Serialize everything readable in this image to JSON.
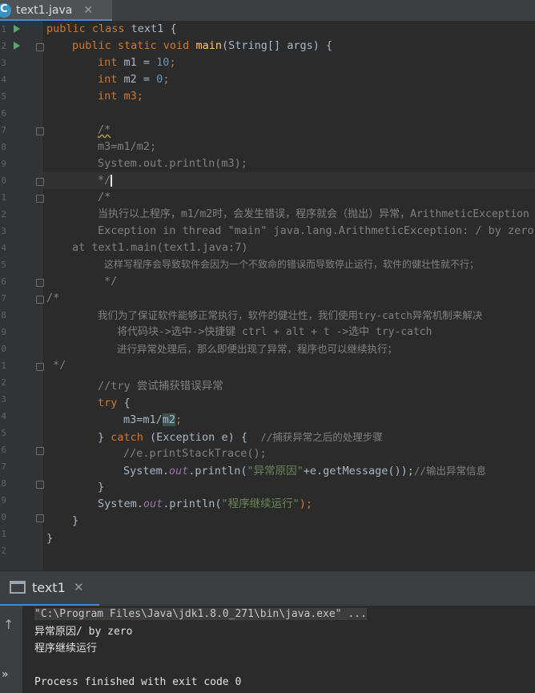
{
  "tab": {
    "icon": "java-class-icon",
    "label": "text1.java",
    "close": "✕"
  },
  "editor": {
    "line_numbers": [
      "1",
      "2",
      "3",
      "4",
      "5",
      "6",
      "7",
      "8",
      "9",
      "0",
      "1",
      "2",
      "3",
      "4",
      "5",
      "6",
      "7",
      "8",
      "9",
      "0",
      "1",
      "2",
      "3",
      "4",
      "5",
      "6",
      "7",
      "8",
      "9",
      "0",
      "1",
      "2"
    ],
    "lines": {
      "l1": {
        "kw": "public class",
        "rest": " text1 {"
      },
      "l2": {
        "kw": "public static void",
        "fn": "main",
        "rest": "(String[] args) {"
      },
      "l3": {
        "kw": "int",
        "a": " m1 = ",
        "num": "10",
        "b": ";"
      },
      "l4": {
        "kw": "int",
        "a": " m2 = ",
        "num": "0",
        "b": ";"
      },
      "l5": {
        "kw": "int",
        "rest": " m3;"
      },
      "l7": "/*",
      "l8": "m3=m1/m2;",
      "l9": "System.out.println(m3);",
      "l10": "*/",
      "l11": "/*",
      "l12": "当执行以上程序，m1/m2时，会发生错误，程序就会（抛出）异常，ArithmeticException",
      "l13": "Exception in thread \"main\" java.lang.ArithmeticException: / by zero",
      "l14": "at text1.main(text1.java:7)",
      "l15": "这样写程序会导致软件会因为一个不致命的错误而导致停止运行，软件的健壮性就不行；",
      "l16": "*/",
      "l17": "/*",
      "l19": "我们为了保证软件能够正常执行，软件的健壮性，我们使用try-catch异常机制来解决",
      "l20": "将代码块->选中->快捷键 ctrl + alt + t ->选中 try-catch",
      "l21": "进行异常处理后，那么即便出现了异常，程序也可以继续执行；",
      "l22": "*/",
      "l23": "//try 尝试捕获错误异常",
      "l24": {
        "kw": "try",
        "rest": " {"
      },
      "l25": {
        "a": "m3=m1/",
        "hl": "m2",
        "b": ";"
      },
      "l26": {
        "a": "} ",
        "kw": "catch",
        "b": " (Exception e) {  ",
        "cm": "//捕获异常之后的处理步骤"
      },
      "l27": "//e.printStackTrace();",
      "l28": {
        "a": "System.",
        "it": "out",
        "b": ".println(",
        "str": "\"异常原因\"",
        "c": "+e.getMessage());",
        "cm": "//输出异常信息"
      },
      "l29": "}",
      "l30": {
        "a": "System.",
        "it": "out",
        "b": ".println(",
        "str": "\"程序继续运行\"",
        "c": ");"
      },
      "l31": "}",
      "l32": "}"
    }
  },
  "run_panel": {
    "label": "text1",
    "close": "✕",
    "console": [
      "\"C:\\Program Files\\Java\\jdk1.8.0_271\\bin\\java.exe\" ...",
      "异常原因/ by zero",
      "程序继续运行",
      "",
      "Process finished with exit code 0"
    ]
  },
  "colors": {
    "background": "#2b2b2b",
    "keyword": "#cc7832",
    "string": "#6a8759",
    "comment": "#808080",
    "number": "#6897bb",
    "method": "#ffc66d"
  }
}
